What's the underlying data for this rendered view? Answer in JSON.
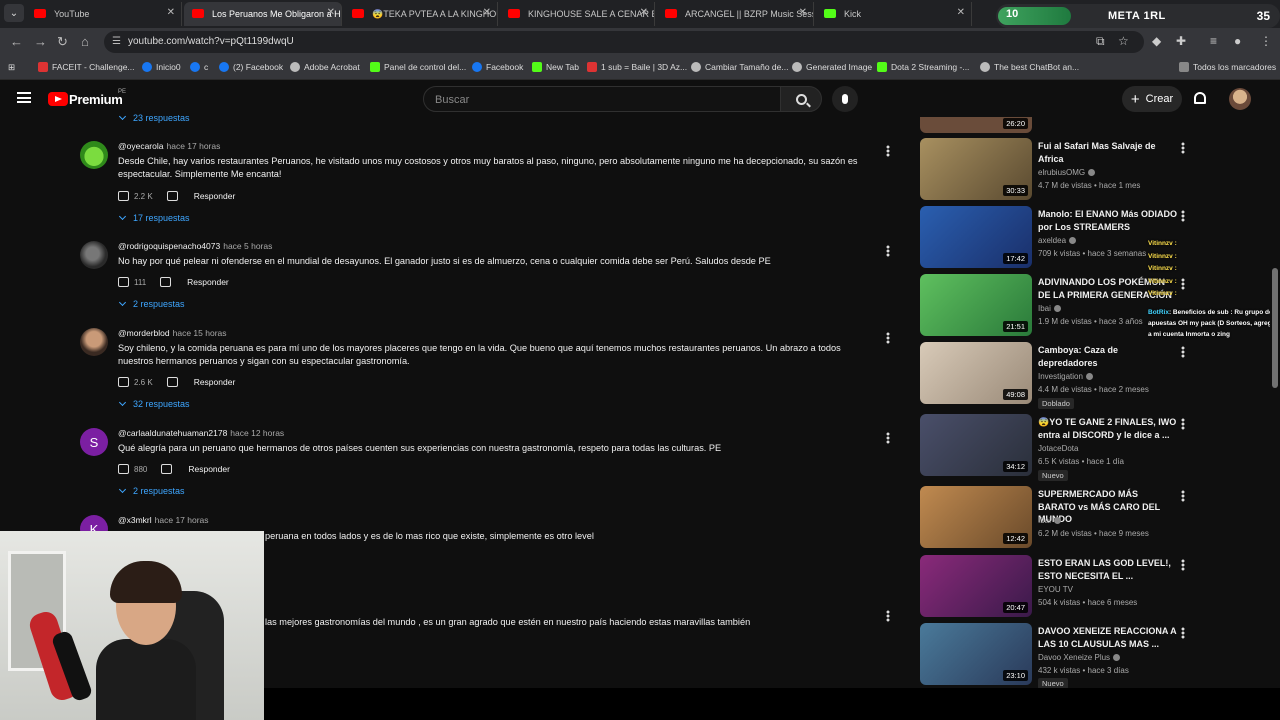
{
  "tabs": [
    {
      "title": "YouTube",
      "active": false,
      "icon": "youtube-favicon"
    },
    {
      "title": "Los Peruanos Me Obligaron a H",
      "active": true,
      "icon": "youtube-favicon"
    },
    {
      "title": "😨TEKA PVTEA A LA KINGHOU",
      "active": false,
      "icon": "youtube-favicon"
    },
    {
      "title": "KINGHOUSE SALE A CENAR EN",
      "active": false,
      "icon": "youtube-favicon"
    },
    {
      "title": "ARCANGEL || BZRP Music Sessi",
      "active": false,
      "icon": "youtube-favicon"
    },
    {
      "title": "Kick",
      "active": false,
      "icon": "kick-favicon"
    }
  ],
  "meta_badge": {
    "level": "10",
    "title": "META 1RL",
    "count": "35",
    "progress": 0.26
  },
  "address": {
    "url": "youtube.com/watch?v=pQt1199dwqU"
  },
  "bookmarks": [
    {
      "label": "FACEIT - Challenge...",
      "icon": "r"
    },
    {
      "label": "Inicio0",
      "icon": "fb"
    },
    {
      "label": "c",
      "icon": "fb"
    },
    {
      "label": "(2) Facebook",
      "icon": "fb"
    },
    {
      "label": "Adobe Acrobat",
      "icon": "g"
    },
    {
      "label": "Panel de control del...",
      "icon": "k"
    },
    {
      "label": "Facebook",
      "icon": "fb"
    },
    {
      "label": "New Tab",
      "icon": "k"
    },
    {
      "label": "1 sub = Baile | 3D Az...",
      "icon": "r"
    },
    {
      "label": "Cambiar Tamaño de...",
      "icon": "g"
    },
    {
      "label": "Generated Image",
      "icon": "g"
    },
    {
      "label": "Dota 2 Streaming -...",
      "icon": "k"
    },
    {
      "label": "The best ChatBot an...",
      "icon": "g"
    },
    {
      "label": "Todos los marcadores",
      "icon": "folder"
    }
  ],
  "header": {
    "brand": "Premium",
    "region": "PE",
    "search_placeholder": "Buscar",
    "create_label": "Crear"
  },
  "top_replies": "23 respuestas",
  "comments": [
    {
      "author": "@oyecarola",
      "time": "hace 17 horas",
      "text": "Desde Chile, hay varios restaurantes Peruanos, he visitado unos muy costosos y otros muy baratos al paso, ninguno, pero absolutamente ninguno me ha decepcionado, su sazón es espectacular. Simplemente Me encanta!",
      "likes": "2.2 K",
      "reply": "Responder",
      "replies": "17 respuestas"
    },
    {
      "author": "@rodrigoquispenacho4073",
      "time": "hace 5 horas",
      "text": "No hay por qué pelear ni ofenderse en el mundial de desayunos. El ganador justo si es de almuerzo, cena o cualquier comida debe ser Perú. Saludos desde PE",
      "likes": "111",
      "reply": "Responder",
      "replies": "2 respuestas"
    },
    {
      "author": "@morderblod",
      "time": "hace 15 horas",
      "text": "Soy chileno, y la comida peruana es para mí uno de los mayores placeres que tengo en la vida. Que bueno que aquí tenemos muchos restaurantes peruanos. Un abrazo a todos nuestros hermanos peruanos y sigan con su espectacular gastronomía.",
      "likes": "2.6 K",
      "reply": "Responder",
      "replies": "32 respuestas"
    },
    {
      "author": "@carlaaldunatehuaman2178",
      "time": "hace 12 horas",
      "text": "Qué alegría para un peruano que hermanos de otros países cuenten sus experiencias con nuestra gastronomía, respeto para todas las culturas. PE",
      "likes": "880",
      "reply": "Responder",
      "replies": "2 respuestas"
    },
    {
      "author": "@x3mkrl",
      "time": "hace 17 horas",
      "text": "peruana en todos lados y es de lo mas rico que existe, simplemente  es otro level"
    },
    {
      "author": "",
      "time": "",
      "text": "las mejores gastronomías del mundo , es un gran agrado que estén en nuestro país haciendo estas maravillas también"
    }
  ],
  "videos": [
    {
      "title": "",
      "channel": "",
      "meta": "",
      "duration": "26:20",
      "thumb": "#6a4c3a"
    },
    {
      "title": "Fui al Safari Mas Salvaje de Africa",
      "channel": "elrubiusOMG",
      "meta": "4.7 M de vistas • hace 1 mes",
      "duration": "30:33",
      "thumb": "#8a7a55"
    },
    {
      "title": "Manolo: El ENANO Más ODIADO por Los STREAMERS",
      "channel": "axeldea",
      "meta": "709 k vistas • hace 3 semanas",
      "duration": "17:42",
      "thumb": "#2a5fb0"
    },
    {
      "title": "ADIVINANDO LOS POKÉMON DE LA PRIMERA GENERACIÓN",
      "channel": "Ibai",
      "meta": "1.9 M de vistas • hace 3 años",
      "duration": "21:51",
      "thumb": "#4aa84a"
    },
    {
      "title": "Camboya: Caza de depredadores",
      "channel": "Investigation",
      "meta": "4.4 M de vistas • hace 2 meses",
      "duration": "49:08",
      "thumb": "#c9b9a8",
      "badge": "Doblado"
    },
    {
      "title": "😨YO TE GANE 2 FINALES, IWO entra al DISCORD y le dice a ...",
      "channel": "JotaceDota",
      "meta": "6.5 K vistas • hace 1 día",
      "duration": "34:12",
      "thumb": "#3b3f55",
      "badge": "Nuevo"
    },
    {
      "title": "SUPERMERCADO MÁS BARATO vs MÁS CARO DEL MUNDO",
      "channel": "Ibai",
      "meta": "6.2 M de vistas • hace 9 meses",
      "duration": "12:42",
      "thumb": "#b07a48"
    },
    {
      "title": "ESTO ERAN LAS GOD LEVEL!, ESTO NECESITA EL ...",
      "channel": "EYOU TV",
      "meta": "504 k vistas • hace 6 meses",
      "duration": "20:47",
      "thumb": "#7a2a6a"
    },
    {
      "title": "DAVOO XENEIZE REACCIONA A LAS 10 CLAUSULAS MAS ...",
      "channel": "Davoo Xeneize Plus",
      "meta": "432 k vistas • hace 3 días",
      "duration": "23:10",
      "thumb": "#3d6a8a",
      "badge": "Nuevo"
    }
  ],
  "overlay_chat": {
    "lines": [
      "Vitinnzv :",
      "Vitinnzv :",
      "Vitinnzv :",
      "Vitinnzv :",
      "Vitinnzv :"
    ],
    "bot_name": "BotRix",
    "bot_text": ": Beneficios de sub : Ru grupo de apuestas OH my pack (D Sorteos, agrego a mi cuenta Inmorta o zing"
  }
}
